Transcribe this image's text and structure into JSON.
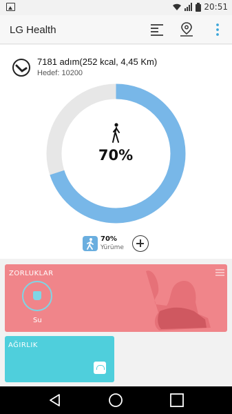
{
  "status_bar": {
    "time": "20:51",
    "icons": [
      "gallery-icon",
      "wifi-icon",
      "signal-icon",
      "battery-icon"
    ]
  },
  "app_bar": {
    "title": "LG Health",
    "actions": [
      "filter-list-icon",
      "location-pin-icon",
      "more-vert-icon"
    ]
  },
  "summary": {
    "steps_text": "7181 adım(252 kcal, 4,45 Km)",
    "goal_text": "Hedef: 10200",
    "center_percent": "70%",
    "progress": 0.7
  },
  "activity": {
    "percent": "70%",
    "label": "Yürüme"
  },
  "cards": {
    "zorluklar": {
      "label": "ZORLUKLAR",
      "item_label": "Su"
    },
    "agirlik": {
      "label": "AĞIRLIK"
    }
  },
  "colors": {
    "progress": "#78b7e8",
    "track": "#e7e7e7",
    "challenge_card": "#f0858a",
    "weight_card": "#4fcfdc",
    "accent": "#3ba6d9"
  },
  "nav_bar": [
    "back-icon",
    "home-icon",
    "recents-icon"
  ]
}
